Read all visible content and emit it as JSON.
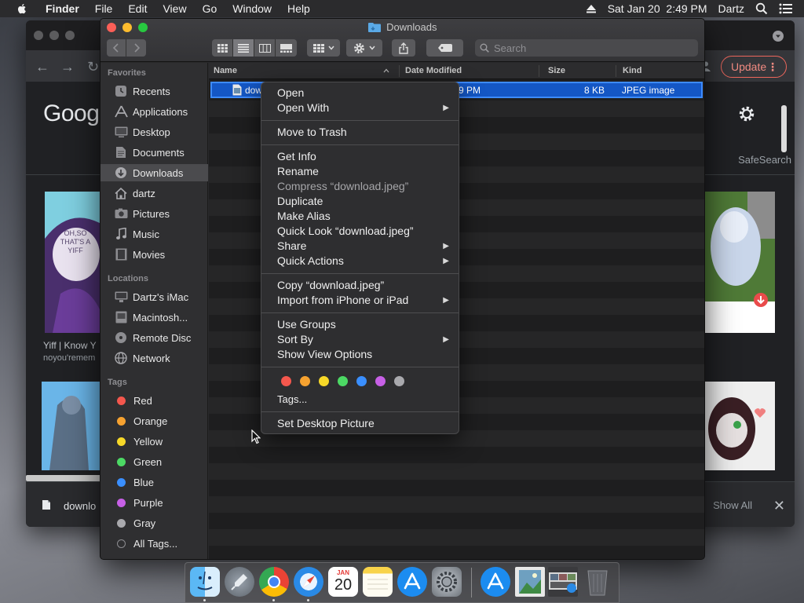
{
  "menubar": {
    "app_name": "Finder",
    "menus": [
      "File",
      "Edit",
      "View",
      "Go",
      "Window",
      "Help"
    ],
    "datetime": "Sat Jan 20  2:49 PM",
    "user": "Dartz"
  },
  "chrome": {
    "logo_text": "Goog",
    "update_label": "Update",
    "safesearch_label": "SafeSearch",
    "result_title": "Yiff | Know Y",
    "result_source": "noyou'remem",
    "download_file": "downlo",
    "show_all_label": "Show All",
    "thumb_caption": "OH,SO THAT'S A YIFF"
  },
  "finder": {
    "title": "Downloads",
    "search_placeholder": "Search",
    "sidebar": {
      "favorites_label": "Favorites",
      "favorites": [
        "Recents",
        "Applications",
        "Desktop",
        "Documents",
        "Downloads",
        "dartz",
        "Pictures",
        "Music",
        "Movies"
      ],
      "locations_label": "Locations",
      "locations": [
        "Dartz's iMac",
        "Macintosh...",
        "Remote Disc",
        "Network"
      ],
      "tags_label": "Tags",
      "tags": [
        {
          "name": "Red",
          "color": "#f4574d"
        },
        {
          "name": "Orange",
          "color": "#f6a230"
        },
        {
          "name": "Yellow",
          "color": "#f7d828"
        },
        {
          "name": "Green",
          "color": "#4cd964"
        },
        {
          "name": "Blue",
          "color": "#3a8fff"
        },
        {
          "name": "Purple",
          "color": "#c760e6"
        },
        {
          "name": "Gray",
          "color": "#a9a9ad"
        }
      ],
      "all_tags_label": "All Tags..."
    },
    "columns": {
      "name": "Name",
      "date_modified": "Date Modified",
      "size": "Size",
      "kind": "Kind"
    },
    "file": {
      "name_visible": "dow",
      "date_visible": "9 PM",
      "size": "8 KB",
      "kind": "JPEG image"
    }
  },
  "context_menu": {
    "items": [
      {
        "label": "Open"
      },
      {
        "label": "Open With",
        "submenu": true
      },
      {
        "label": "Move to Trash"
      },
      {
        "label": "Get Info"
      },
      {
        "label": "Rename"
      },
      {
        "label": "Compress “download.jpeg”",
        "disabled": true
      },
      {
        "label": "Duplicate"
      },
      {
        "label": "Make Alias"
      },
      {
        "label": "Quick Look “download.jpeg”"
      },
      {
        "label": "Share",
        "submenu": true
      },
      {
        "label": "Quick Actions",
        "submenu": true
      },
      {
        "label": "Copy “download.jpeg”"
      },
      {
        "label": "Import from iPhone or iPad",
        "submenu": true
      },
      {
        "label": "Use Groups"
      },
      {
        "label": "Sort By",
        "submenu": true
      },
      {
        "label": "Show View Options"
      },
      {
        "label": "Tags..."
      },
      {
        "label": "Set Desktop Picture"
      }
    ],
    "tag_colors": [
      "#f4574d",
      "#f6a230",
      "#f7d828",
      "#4cd964",
      "#3a8fff",
      "#c760e6",
      "#a9a9ad"
    ]
  },
  "dock": {
    "calendar_month": "JAN",
    "calendar_day": "20",
    "apps": [
      "finder",
      "launchpad",
      "chrome",
      "safari",
      "calendar",
      "notes",
      "app-store",
      "system-preferences",
      "app-store-2",
      "preview",
      "photo-booth",
      "trash"
    ]
  }
}
